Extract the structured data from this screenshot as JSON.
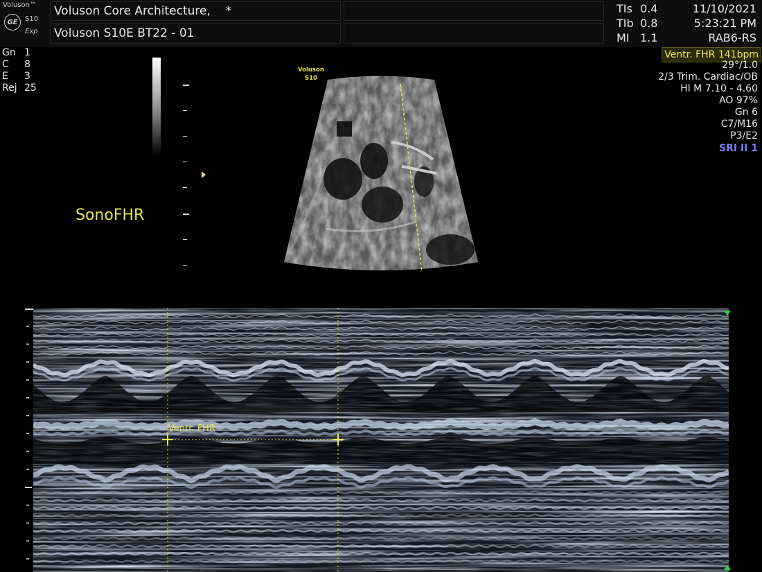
{
  "header": {
    "brand": "Voluson™",
    "logo": "GE",
    "model": "S10",
    "mode": "Exp",
    "title": "Voluson Core Architecture,    *",
    "subtitle": "Voluson S10E BT22 - 01",
    "indices": [
      {
        "label": "TIs",
        "value": "0.4"
      },
      {
        "label": "TIb",
        "value": "0.8"
      },
      {
        "label": "MI",
        "value": "1.1"
      }
    ],
    "date": "11/10/2021",
    "time": "5:23:21 PM",
    "probe": "RAB6-RS"
  },
  "left_params": [
    {
      "label": "Gn",
      "value": "1"
    },
    {
      "label": "C",
      "value": "8"
    },
    {
      "label": "E",
      "value": "3"
    },
    {
      "label": "Rej",
      "value": "25"
    }
  ],
  "mode_label": "SonoFHR",
  "probe_logo": {
    "line1": "Voluson",
    "line2": "S10"
  },
  "measurement": {
    "badge": "Ventr. FHR 141bpm",
    "caliper_label": "Ventr. FHR"
  },
  "right_params": [
    "29°/1.0",
    "2/3 Trim. Cardiac/OB",
    "HI M  7.10 - 4.60",
    "AO 97%",
    "Gn   6",
    "C7/M16",
    "P3/E2"
  ],
  "sri": "SRI II 1",
  "colors": {
    "accent_yellow": "#ece44c",
    "sri_blue": "#7b7bff",
    "marker_green": "#2dd34a",
    "mmode_tint": "#b8cce6"
  },
  "icons": [
    "ge-logo-icon",
    "focus-marker-icon",
    "caliper-cross-icon",
    "green-triangle-icon"
  ]
}
